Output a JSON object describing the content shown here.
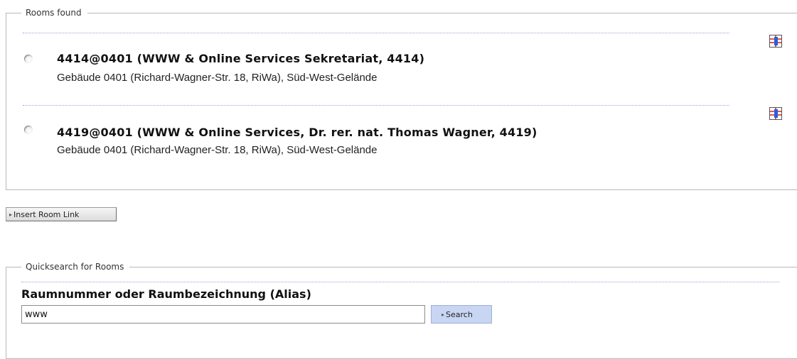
{
  "rooms_found": {
    "legend": "Rooms found",
    "rooms": [
      {
        "title": "4414@0401 (WWW & Online Services Sekretariat, 4414)",
        "subtitle": "Gebäude 0401 (Richard-Wagner-Str. 18, RiWa), Süd-West-Gelände",
        "selected": false
      },
      {
        "title": "4419@0401 (WWW & Online Services, Dr. rer. nat. Thomas Wagner, 4419)",
        "subtitle": "Gebäude 0401 (Richard-Wagner-Str. 18, RiWa), Süd-West-Gelände",
        "selected": false
      }
    ],
    "map_icon": "floorplan-icon"
  },
  "insert_button": {
    "label": "Insert Room Link"
  },
  "quicksearch": {
    "legend": "Quicksearch for Rooms",
    "field_label": "Raumnummer oder Raumbezeichnung (Alias)",
    "input_value": "www",
    "search_label": "Search"
  },
  "colors": {
    "border": "#b8b8b8",
    "dotted_line": "#9aa7d8",
    "search_button_bg": "#c9d6f3",
    "map_icon_red": "#d02020",
    "map_icon_blue": "#2a5fd8"
  }
}
